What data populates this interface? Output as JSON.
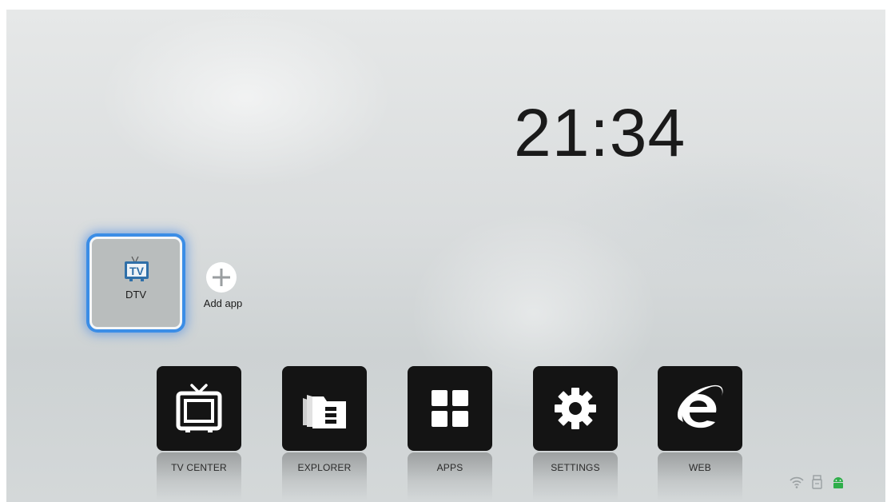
{
  "clock": {
    "time": "21:34"
  },
  "focused_app": {
    "label": "DTV",
    "icon": "tv-icon"
  },
  "add_app": {
    "label": "Add app",
    "icon": "plus-icon"
  },
  "dock": [
    {
      "label": "TV CENTER",
      "icon": "tv-center-icon"
    },
    {
      "label": "EXPLORER",
      "icon": "folder-icon"
    },
    {
      "label": "APPS",
      "icon": "apps-grid-icon"
    },
    {
      "label": "SETTINGS",
      "icon": "gear-icon"
    },
    {
      "label": "WEB",
      "icon": "browser-e-icon"
    }
  ],
  "status_bar": {
    "icons": [
      "wifi-icon",
      "usb-icon",
      "android-icon"
    ],
    "android_color": "#2fae4a"
  },
  "colors": {
    "focus_glow": "#3b8de6",
    "tile_dark": "#141414"
  }
}
